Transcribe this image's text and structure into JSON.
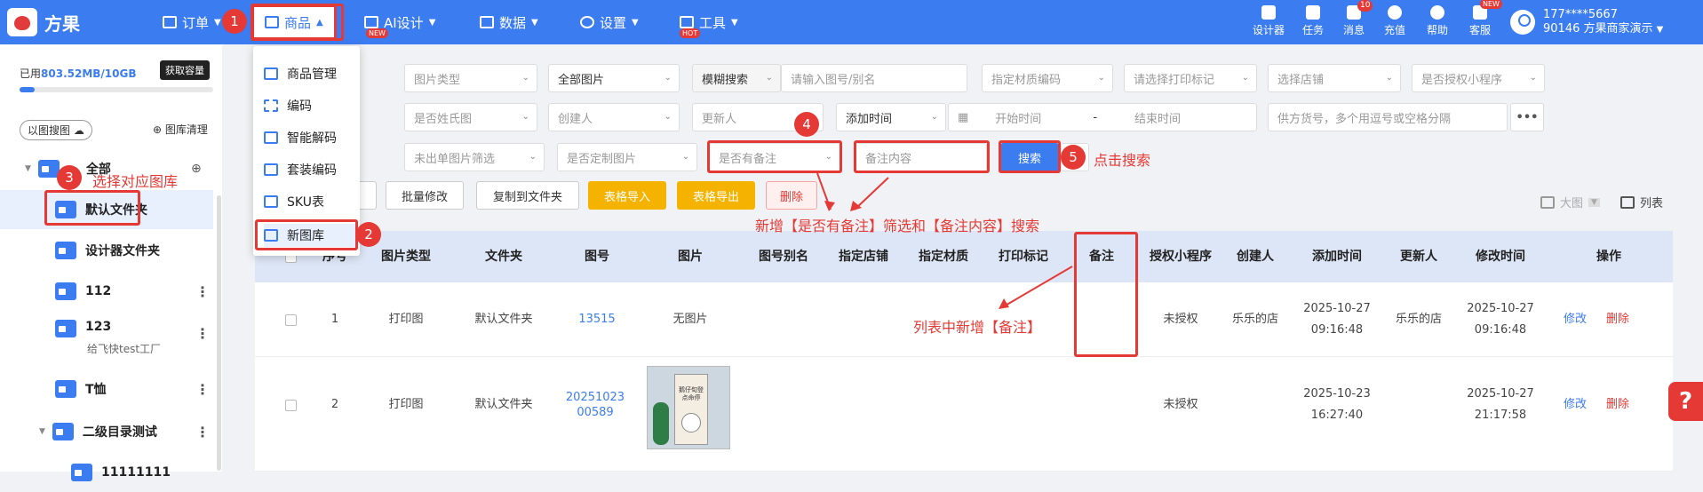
{
  "app": {
    "name": "方果"
  },
  "nav": {
    "items": [
      {
        "label": "订单"
      },
      {
        "label": "商品"
      },
      {
        "label": "AI设计",
        "badge": "NEW"
      },
      {
        "label": "数据"
      },
      {
        "label": "设置"
      },
      {
        "label": "工具",
        "badge": "HOT"
      }
    ]
  },
  "top_right": [
    {
      "label": "设计器",
      "icon": "designer-icon"
    },
    {
      "label": "任务",
      "icon": "task-icon"
    },
    {
      "label": "消息",
      "icon": "message-icon",
      "count": "10"
    },
    {
      "label": "充值",
      "icon": "recharge-icon"
    },
    {
      "label": "帮助",
      "icon": "help-icon"
    },
    {
      "label": "客服",
      "icon": "service-icon",
      "badge": "NEW"
    }
  ],
  "user": {
    "phone": "177****5667",
    "shop": "90146 方果商家演示"
  },
  "storage": {
    "prefix": "已用",
    "used": "803.52MB/10GB",
    "button": "获取容量",
    "fraction": 0.08
  },
  "sidebar_actions": {
    "search_by_image": "以图搜图",
    "clean": "图库清理"
  },
  "tree": [
    {
      "label": "全部"
    },
    {
      "label": "默认文件夹"
    },
    {
      "label": "设计器文件夹"
    },
    {
      "label": "112"
    },
    {
      "label": "123",
      "sub": "给飞快test工厂"
    },
    {
      "label": "T恤"
    },
    {
      "label": "二级目录测试"
    },
    {
      "label": "11111111"
    }
  ],
  "menu": [
    {
      "label": "商品管理"
    },
    {
      "label": "编码"
    },
    {
      "label": "智能解码"
    },
    {
      "label": "套装编码"
    },
    {
      "label": "SKU表"
    },
    {
      "label": "新图库"
    }
  ],
  "filters": {
    "row1": [
      "图片类型",
      "全部图片",
      "模糊搜索",
      "请输入图号/别名",
      "指定材质编码",
      "请选择打印标记",
      "选择店铺",
      "是否授权小程序"
    ],
    "row2": [
      "是否姓氏图",
      "创建人",
      "更新人",
      "添加时间",
      "开始时间",
      "-",
      "结束时间",
      "供方货号，多个用逗号或空格分隔",
      "•••"
    ],
    "row3": [
      "未出单图片筛选",
      "是否定制图片",
      "是否有备注",
      "备注内容"
    ],
    "search": "搜索"
  },
  "toolbar": {
    "batch_edit": "批量修改",
    "copy_to_folder": "复制到文件夹",
    "import": "表格导入",
    "export": "表格导出",
    "delete": "删除",
    "view_grid": "大图",
    "view_list": "列表"
  },
  "table": {
    "headers": [
      "序号",
      "图片类型",
      "文件夹",
      "图号",
      "图片",
      "图号别名",
      "指定店铺",
      "指定材质",
      "打印标记",
      "备注",
      "授权小程序",
      "创建人",
      "添加时间",
      "更新人",
      "修改时间",
      "操作"
    ],
    "rows": [
      {
        "index": "1",
        "type": "打印图",
        "folder": "默认文件夹",
        "code": "13515",
        "image": "无图片",
        "auth": "未授权",
        "creator": "乐乐的店",
        "added": "2025-10-27 09:16:48",
        "updater": "乐乐的店",
        "modified": "2025-10-27 09:16:48",
        "edit": "修改",
        "remove": "删除"
      },
      {
        "index": "2",
        "type": "打印图",
        "folder": "默认文件夹",
        "code": "20251023 00589",
        "image": "",
        "auth": "未授权",
        "creator": "",
        "added": "2025-10-23 16:27:40",
        "updater": "",
        "modified": "2025-10-27 21:17:58",
        "edit": "修改",
        "remove": "删除"
      }
    ],
    "thumb_caption": "鹅仔旬登 点命停"
  },
  "annotations": {
    "n1": "1",
    "n2": "2",
    "n3": "3",
    "n4": "4",
    "n5": "5",
    "select_folder": "选择对应图库",
    "click_search": "点击搜索",
    "new_filter": "新增【是否有备注】筛选和【备注内容】搜索",
    "new_column": "列表中新增【备注】"
  },
  "fab": {
    "label": "?"
  },
  "colors": {
    "primary": "#3b7cf0",
    "annotation": "#e53935",
    "warning": "#f5b300"
  }
}
